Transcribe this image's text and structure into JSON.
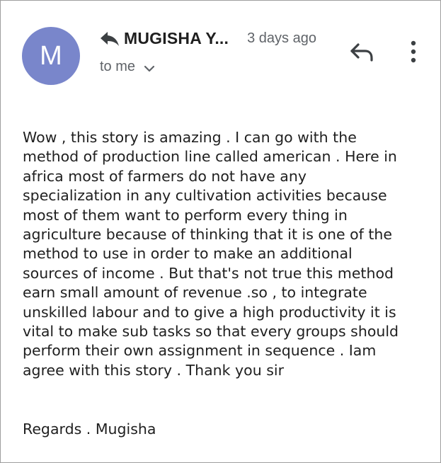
{
  "sender": {
    "avatar_initial": "M",
    "avatar_color": "#7986cb",
    "name": "MUGISHA Y...",
    "time": "3 days ago",
    "recipient": "to me"
  },
  "icons": {
    "reply_all": "reply-all-icon",
    "reply": "reply-icon",
    "more": "more-vertical-icon",
    "recipient_details": "chevron-down-icon"
  },
  "message": {
    "body": "Wow , this story is amazing . I can go with the\nmethod of production line called american . Here in\nafrica most of farmers do not have any\nspecialization in any cultivation activities because\nmost of them want to perform every thing in\nagriculture because of thinking that it is one of the\nmethod to use in order to make an additional\nsources of income . But that's not true this method\nearn small amount of revenue .so , to integrate\nunskilled labour and to give a high productivity it is\nvital to make sub tasks so that every groups should\nperform their own assignment in sequence . Iam\nagree with this story . Thank you sir",
    "signature": "Regards . Mugisha"
  }
}
